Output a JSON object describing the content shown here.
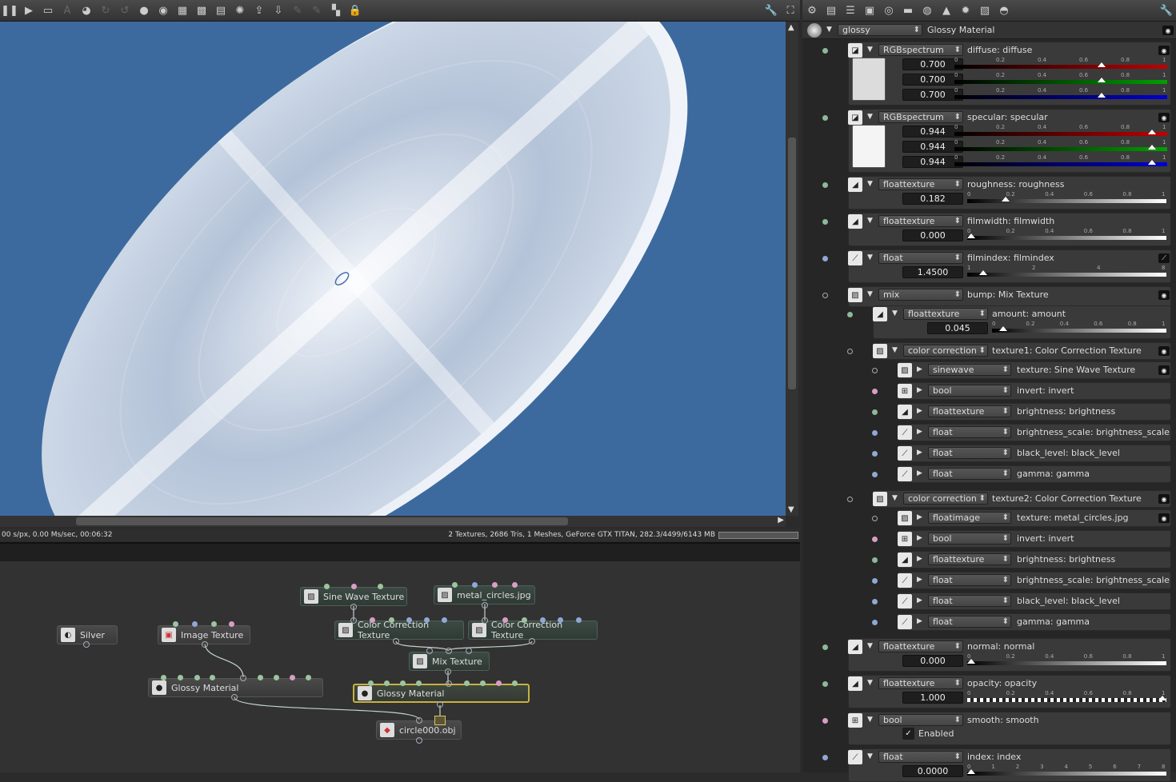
{
  "viewer": {
    "status_left": "00 s/px, 0.00 Ms/sec, 00:06:32",
    "status_right": "2 Textures, 2686 Tris, 1 Meshes, GeForce GTX TITAN, 282.3/4499/6143 MB",
    "background_color": "#3d6a9e"
  },
  "toolbar_left_icons": [
    "pause-icon",
    "play-icon",
    "monitor-icon",
    "aa-icon",
    "color-icon",
    "refresh-icon",
    "reset-icon",
    "sphere-icon",
    "sphere2-icon",
    "grid-icon",
    "grid2-icon",
    "grid3-icon",
    "spark-icon",
    "export-icon",
    "import-icon",
    "lock1-icon",
    "lock2-icon",
    "checker-icon",
    "lock-icon"
  ],
  "toolbar_right_icons": [
    "settings-icon",
    "folders-icon",
    "list-icon",
    "image-icon",
    "camera-icon",
    "film-icon",
    "globe-icon",
    "picture-icon",
    "sun-icon",
    "texture-icon",
    "paint-icon"
  ],
  "nodes": [
    {
      "id": "silver",
      "label": "Silver",
      "icon": "material-icon"
    },
    {
      "id": "image",
      "label": "Image Texture",
      "icon": "image-texture-icon"
    },
    {
      "id": "sine",
      "label": "Sine Wave Texture",
      "icon": "texture-icon"
    },
    {
      "id": "metal",
      "label": "metal_circles.jpg",
      "icon": "texture-icon"
    },
    {
      "id": "cc1",
      "label": "Color Correction Texture",
      "icon": "texture-icon"
    },
    {
      "id": "cc2",
      "label": "Color Correction Texture",
      "icon": "texture-icon"
    },
    {
      "id": "mix",
      "label": "Mix Texture",
      "icon": "texture-icon"
    },
    {
      "id": "glossy1",
      "label": "Glossy Material",
      "icon": "sphere-icon"
    },
    {
      "id": "glossy2",
      "label": "Glossy Material",
      "icon": "sphere-icon"
    },
    {
      "id": "mesh",
      "label": "circle000.obj",
      "icon": "mesh-icon"
    }
  ],
  "inspector": {
    "header_type": "glossy",
    "header_name": "Glossy Material",
    "enabled_label": "Enabled",
    "rows": [
      {
        "type": "RGBspectrum",
        "label": "diffuse: diffuse",
        "values": [
          "0.700",
          "0.700",
          "0.700"
        ],
        "swatch": "#dcdcdc",
        "rgb": [
          0.7,
          0.7,
          0.7
        ]
      },
      {
        "type": "RGBspectrum",
        "label": "specular: specular",
        "values": [
          "0.944",
          "0.944",
          "0.944"
        ],
        "swatch": "#f4f4f4",
        "rgb": [
          0.944,
          0.944,
          0.944
        ]
      },
      {
        "type": "floattexture",
        "label": "roughness: roughness",
        "value": "0.182",
        "pos": 0.182
      },
      {
        "type": "floattexture",
        "label": "filmwidth: filmwidth",
        "value": "0.000",
        "pos": 0.0
      },
      {
        "type": "float",
        "label": "filmindex: filmindex",
        "value": "1.4500",
        "pos": 0.064
      },
      {
        "type": "mix",
        "label": "bump: Mix Texture"
      },
      {
        "type": "floattexture",
        "label": "amount: amount",
        "value": "0.045",
        "pos": 0.045
      },
      {
        "type": "color correction",
        "label": "texture1: Color Correction Texture"
      },
      {
        "type": "sinewave",
        "label": "texture: Sine Wave Texture"
      },
      {
        "type": "bool",
        "label": "invert: invert"
      },
      {
        "type": "floattexture",
        "label": "brightness: brightness"
      },
      {
        "type": "float",
        "label": "brightness_scale: brightness_scale"
      },
      {
        "type": "float",
        "label": "black_level: black_level"
      },
      {
        "type": "float",
        "label": "gamma: gamma"
      },
      {
        "type": "color correction",
        "label": "texture2: Color Correction Texture"
      },
      {
        "type": "floatimage",
        "label": "texture: metal_circles.jpg"
      },
      {
        "type": "bool",
        "label": "invert: invert"
      },
      {
        "type": "floattexture",
        "label": "brightness: brightness"
      },
      {
        "type": "float",
        "label": "brightness_scale: brightness_scale"
      },
      {
        "type": "float",
        "label": "black_level: black_level"
      },
      {
        "type": "float",
        "label": "gamma: gamma"
      },
      {
        "type": "floattexture",
        "label": "normal: normal",
        "value": "0.000",
        "pos": 0.0
      },
      {
        "type": "floattexture",
        "label": "opacity: opacity",
        "value": "1.000",
        "pos": 1.0
      },
      {
        "type": "bool",
        "label": "smooth: smooth"
      },
      {
        "type": "float",
        "label": "index: index",
        "value": "0.0000",
        "pos": 0.0
      }
    ],
    "ticks_01": [
      "0",
      "0.2",
      "0.4",
      "0.6",
      "0.8",
      "1"
    ],
    "ticks_filmindex": [
      "1",
      "2",
      "4",
      "8"
    ],
    "ticks_index": [
      "0",
      "1",
      "2",
      "3",
      "4",
      "5",
      "6",
      "7",
      "8"
    ]
  }
}
